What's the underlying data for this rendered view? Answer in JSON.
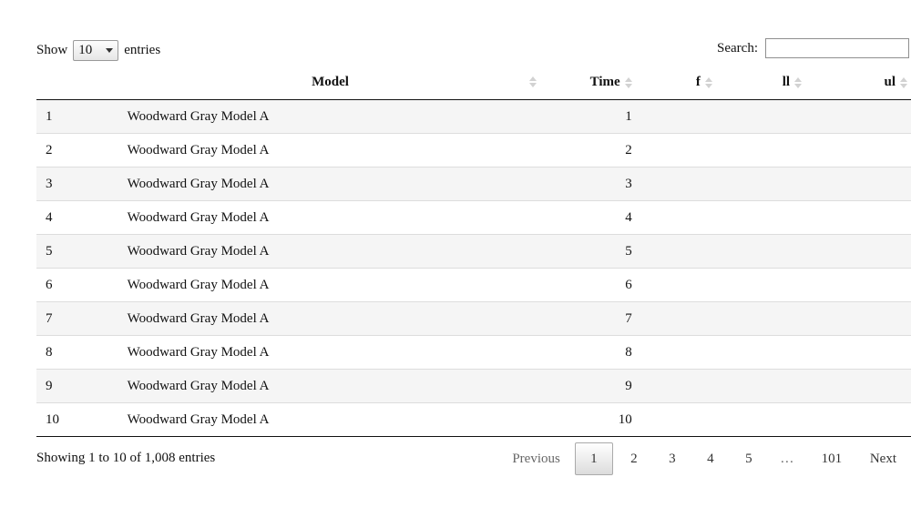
{
  "length": {
    "show_label": "Show",
    "value": "10",
    "entries_label": "entries"
  },
  "search": {
    "label": "Search:",
    "value": ""
  },
  "table": {
    "columns": [
      {
        "label": ""
      },
      {
        "label": "Model"
      },
      {
        "label": "Time"
      },
      {
        "label": "f"
      },
      {
        "label": "ll"
      },
      {
        "label": "ul"
      }
    ],
    "rows": [
      {
        "id": "1",
        "model": "Woodward Gray Model A",
        "time": "1",
        "f": "",
        "ll": "",
        "ul": ""
      },
      {
        "id": "2",
        "model": "Woodward Gray Model A",
        "time": "2",
        "f": "",
        "ll": "",
        "ul": ""
      },
      {
        "id": "3",
        "model": "Woodward Gray Model A",
        "time": "3",
        "f": "",
        "ll": "",
        "ul": ""
      },
      {
        "id": "4",
        "model": "Woodward Gray Model A",
        "time": "4",
        "f": "",
        "ll": "",
        "ul": ""
      },
      {
        "id": "5",
        "model": "Woodward Gray Model A",
        "time": "5",
        "f": "",
        "ll": "",
        "ul": ""
      },
      {
        "id": "6",
        "model": "Woodward Gray Model A",
        "time": "6",
        "f": "",
        "ll": "",
        "ul": ""
      },
      {
        "id": "7",
        "model": "Woodward Gray Model A",
        "time": "7",
        "f": "",
        "ll": "",
        "ul": ""
      },
      {
        "id": "8",
        "model": "Woodward Gray Model A",
        "time": "8",
        "f": "",
        "ll": "",
        "ul": ""
      },
      {
        "id": "9",
        "model": "Woodward Gray Model A",
        "time": "9",
        "f": "",
        "ll": "",
        "ul": ""
      },
      {
        "id": "10",
        "model": "Woodward Gray Model A",
        "time": "10",
        "f": "",
        "ll": "",
        "ul": ""
      }
    ]
  },
  "info": "Showing 1 to 10 of 1,008 entries",
  "pagination": {
    "previous": "Previous",
    "pages": [
      "1",
      "2",
      "3",
      "4",
      "5"
    ],
    "current": "1",
    "ellipsis": "…",
    "last": "101",
    "next": "Next"
  },
  "icons": {
    "sort": "sort-both-icon",
    "select_caret": "chevron-down-icon"
  }
}
